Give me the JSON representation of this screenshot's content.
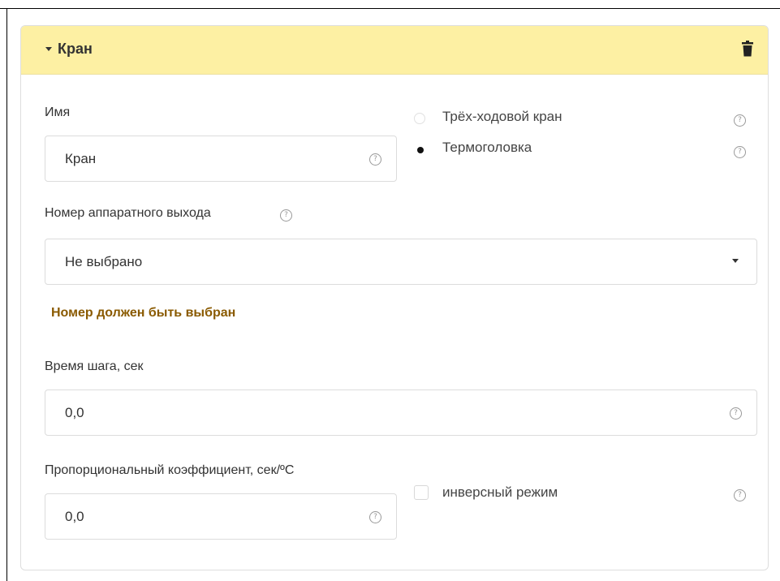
{
  "card": {
    "title": "Кран",
    "name_label": "Имя",
    "name_value": "Кран",
    "valve_types": [
      {
        "label": "Трёх-ходовой кран",
        "checked": false
      },
      {
        "label": "Термоголовка",
        "checked": true
      }
    ],
    "output_label": "Номер аппаратного выхода",
    "output_selected": "Не выбрано",
    "output_warning": "Номер должен быть выбран",
    "step_time_label": "Время шага, сек",
    "step_time_value": "0,0",
    "prop_coef_label": "Пропорциональный коэффициент, сек/ºC",
    "prop_coef_value": "0,0",
    "inverse_label": "инверсный режим",
    "inverse_checked": false,
    "help_glyph": "?"
  },
  "colors": {
    "header_bg": "#fdf0a3",
    "warning_text": "#8a5a00"
  },
  "icons": {
    "collapse": "caret-down-icon",
    "delete": "trash-icon",
    "help": "question-circle-icon"
  }
}
